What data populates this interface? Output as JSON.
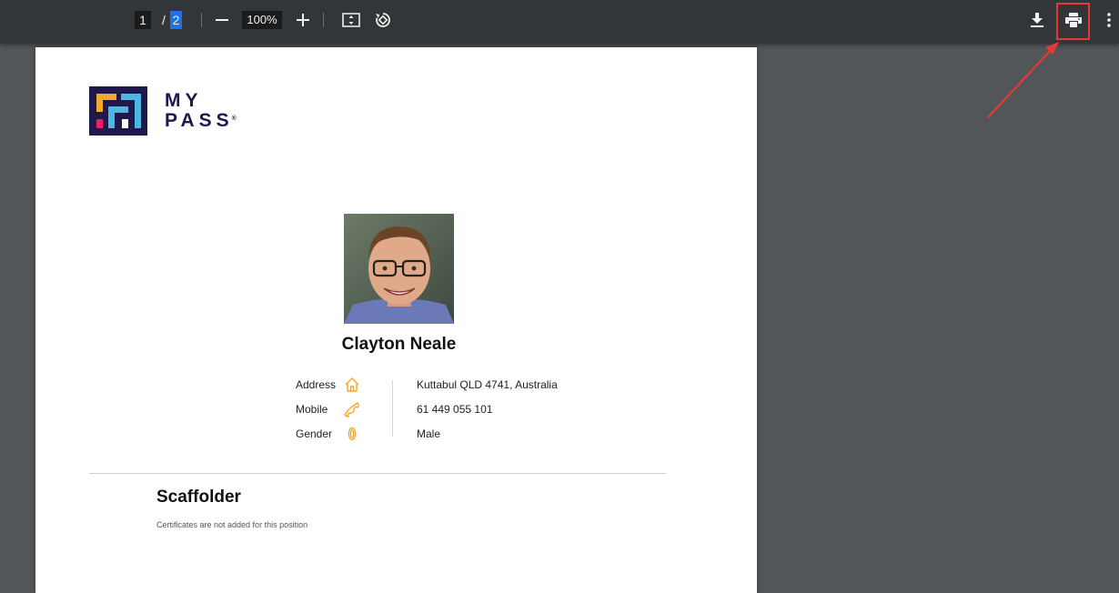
{
  "toolbar": {
    "page_current": "1",
    "page_separator": "/",
    "page_total": "2",
    "zoom": "100%",
    "icons": [
      "minus-icon",
      "plus-icon",
      "fit-page-icon",
      "rotate-icon",
      "download-icon",
      "print-icon",
      "more-vert-icon"
    ]
  },
  "document": {
    "logo": {
      "line1": "MY",
      "line2": "PASS",
      "reg": "®"
    },
    "person": {
      "name": "Clayton Neale"
    },
    "fields": [
      {
        "label": "Address",
        "icon": "home-icon",
        "value": "Kuttabul QLD 4741, Australia"
      },
      {
        "label": "Mobile",
        "icon": "phone-icon",
        "value": "61 449 055 101"
      },
      {
        "label": "Gender",
        "icon": "gender-icon",
        "value": "Male"
      }
    ],
    "position": {
      "title": "Scaffolder",
      "note": "Certificates are not added for this position"
    }
  },
  "colors": {
    "toolbar_bg": "#323639",
    "viewer_bg": "#525659",
    "accent_blue": "#1a73e8",
    "icon_orange": "#f0a92b",
    "annotation_red": "#e53935",
    "logo_navy": "#1d1a4b"
  }
}
